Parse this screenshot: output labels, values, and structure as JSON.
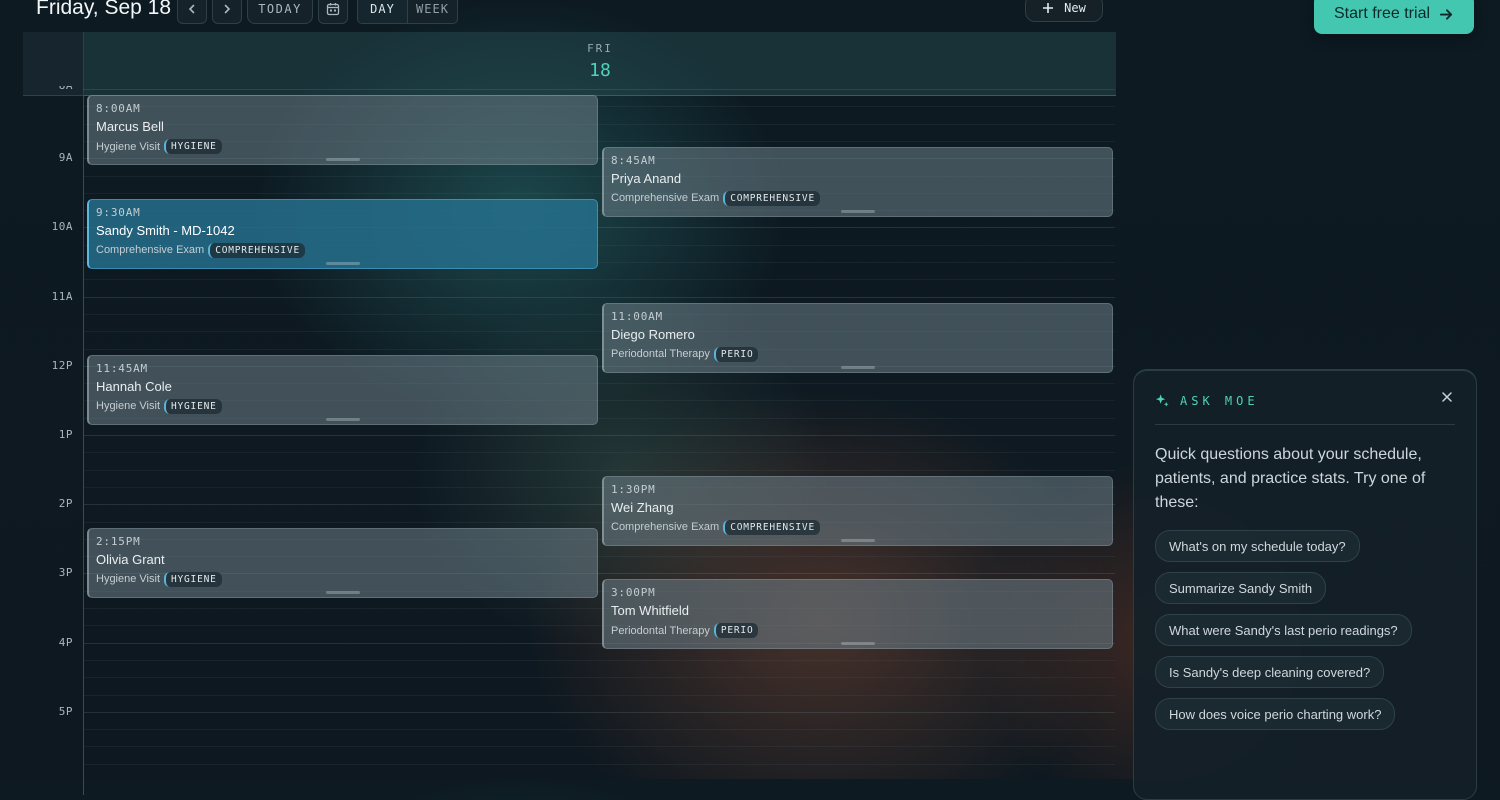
{
  "header": {
    "date_title": "Friday, Sep 18",
    "today_label": "TODAY",
    "views": [
      "DAY",
      "WEEK"
    ],
    "active_view": "DAY",
    "new_label": "New",
    "trial_label": "Start free trial"
  },
  "calendar": {
    "day_name": "FRI",
    "day_number": "18",
    "hours": [
      "8A",
      "9A",
      "10A",
      "11A",
      "12P",
      "1P",
      "2P",
      "3P",
      "4P",
      "5P"
    ],
    "appointments": [
      {
        "time": "8:00AM",
        "name": "Marcus Bell",
        "type": "Hygiene Visit",
        "tag": "HYGIENE"
      },
      {
        "time": "8:45AM",
        "name": "Priya Anand",
        "type": "Comprehensive Exam",
        "tag": "COMPREHENSIVE"
      },
      {
        "time": "9:30AM",
        "name": "Sandy Smith - MD-1042",
        "type": "Comprehensive Exam",
        "tag": "COMPREHENSIVE",
        "selected": true
      },
      {
        "time": "11:00AM",
        "name": "Diego Romero",
        "type": "Periodontal Therapy",
        "tag": "PERIO"
      },
      {
        "time": "11:45AM",
        "name": "Hannah Cole",
        "type": "Hygiene Visit",
        "tag": "HYGIENE"
      },
      {
        "time": "1:30PM",
        "name": "Wei Zhang",
        "type": "Comprehensive Exam",
        "tag": "COMPREHENSIVE"
      },
      {
        "time": "2:15PM",
        "name": "Olivia Grant",
        "type": "Hygiene Visit",
        "tag": "HYGIENE"
      },
      {
        "time": "3:00PM",
        "name": "Tom Whitfield",
        "type": "Periodontal Therapy",
        "tag": "PERIO"
      }
    ]
  },
  "assistant": {
    "title": "ASK MOE",
    "intro": "Quick questions about your schedule, patients, and practice stats. Try one of these:",
    "suggestions": [
      "What's on my schedule today?",
      "Summarize Sandy Smith",
      "What were Sandy's last perio readings?",
      "Is Sandy's deep cleaning covered?",
      "How does voice perio charting work?"
    ]
  },
  "colors": {
    "accent": "#4fd1bb",
    "trial_button": "#44c7b1",
    "selected_appointment": "#266e8c"
  }
}
